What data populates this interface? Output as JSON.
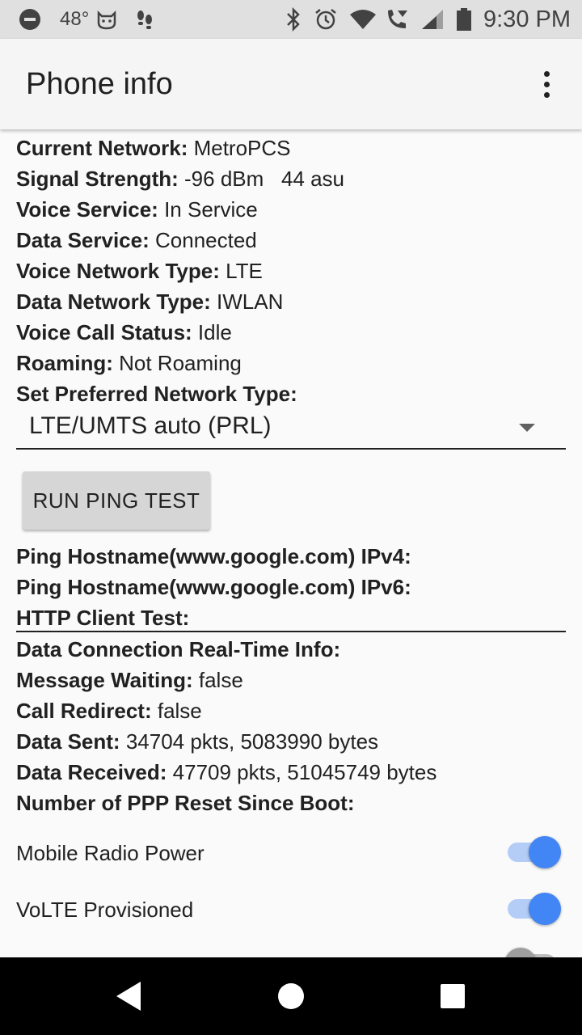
{
  "status_bar": {
    "temperature": "48°",
    "time": "9:30 PM",
    "icons_left": [
      "dnd-icon",
      "temperature-icon",
      "cat-face-icon",
      "footprints-icon"
    ],
    "icons_right": [
      "bluetooth-icon",
      "alarm-icon",
      "wifi-icon",
      "wifi-calling-icon",
      "signal-icon",
      "battery-icon"
    ]
  },
  "app_bar": {
    "title": "Phone info"
  },
  "info": [
    {
      "label": "Current Network:",
      "value": "MetroPCS"
    },
    {
      "label": "Signal Strength:",
      "value": "-96 dBm   44 asu"
    },
    {
      "label": "Voice Service:",
      "value": "In Service"
    },
    {
      "label": "Data Service:",
      "value": "Connected"
    },
    {
      "label": "Voice Network Type:",
      "value": "LTE"
    },
    {
      "label": "Data Network Type:",
      "value": "IWLAN"
    },
    {
      "label": "Voice Call Status:",
      "value": "Idle"
    },
    {
      "label": "Roaming:",
      "value": "Not Roaming"
    },
    {
      "label": "Set Preferred Network Type:",
      "value": ""
    }
  ],
  "preferred_network": {
    "selected": "LTE/UMTS auto (PRL)"
  },
  "ping_button": {
    "label": "RUN PING TEST"
  },
  "ping_results": [
    {
      "label": "Ping Hostname(www.google.com) IPv4:",
      "value": ""
    },
    {
      "label": "Ping Hostname(www.google.com) IPv6:",
      "value": ""
    },
    {
      "label": "HTTP Client Test:",
      "value": ""
    }
  ],
  "data_info": [
    {
      "label": "Data Connection Real-Time Info:",
      "value": ""
    },
    {
      "label": "Message Waiting:",
      "value": "false"
    },
    {
      "label": "Call Redirect:",
      "value": "false"
    },
    {
      "label": "Data Sent:",
      "value": "34704 pkts, 5083990 bytes"
    },
    {
      "label": "Data Received:",
      "value": "47709 pkts, 51045749 bytes"
    },
    {
      "label": "Number of PPP Reset Since Boot:",
      "value": ""
    }
  ],
  "switches": [
    {
      "label": "Mobile Radio Power",
      "on": true
    },
    {
      "label": "VoLTE Provisioned",
      "on": true
    }
  ],
  "colors": {
    "accent": "#4285f4",
    "status_bar_bg": "#e0e0e0",
    "app_bar_bg": "#f5f5f5",
    "nav_bar_bg": "#000000"
  }
}
